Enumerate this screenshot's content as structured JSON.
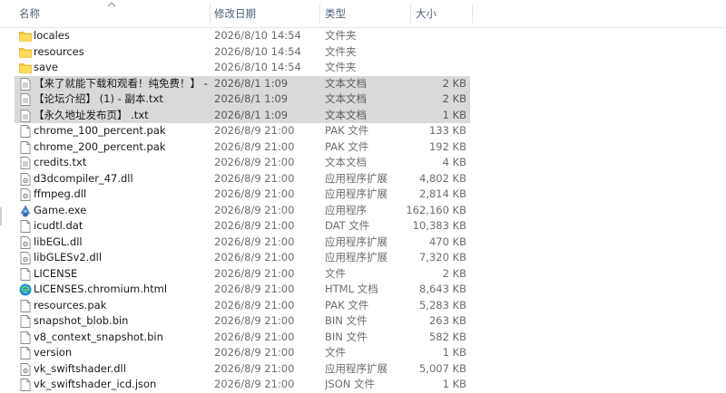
{
  "header": {
    "name_label": "名称",
    "date_label": "修改日期",
    "type_label": "类型",
    "size_label": "大小"
  },
  "files": [
    {
      "name": "locales",
      "date": "2026/8/10 14:54",
      "type": "文件夹",
      "size": "",
      "icon": "folder-icon",
      "selected": false
    },
    {
      "name": "resources",
      "date": "2026/8/10 14:54",
      "type": "文件夹",
      "size": "",
      "icon": "folder-icon",
      "selected": false
    },
    {
      "name": "save",
      "date": "2026/8/10 14:54",
      "type": "文件夹",
      "size": "",
      "icon": "folder-icon",
      "selected": false
    },
    {
      "name": "【来了就能下载和观看！纯免费！】 - 副...",
      "date": "2026/8/1 1:09",
      "type": "文本文档",
      "size": "2 KB",
      "icon": "text-file-icon",
      "selected": true
    },
    {
      "name": "【论坛介绍】 (1) - 副本.txt",
      "date": "2026/8/1 1:09",
      "type": "文本文档",
      "size": "2 KB",
      "icon": "text-file-icon",
      "selected": true
    },
    {
      "name": "【永久地址发布页】 .txt",
      "date": "2026/8/1 1:09",
      "type": "文本文档",
      "size": "1 KB",
      "icon": "text-file-icon",
      "selected": true
    },
    {
      "name": "chrome_100_percent.pak",
      "date": "2026/8/9 21:00",
      "type": "PAK 文件",
      "size": "133 KB",
      "icon": "file-icon",
      "selected": false
    },
    {
      "name": "chrome_200_percent.pak",
      "date": "2026/8/9 21:00",
      "type": "PAK 文件",
      "size": "192 KB",
      "icon": "file-icon",
      "selected": false
    },
    {
      "name": "credits.txt",
      "date": "2026/8/9 21:00",
      "type": "文本文档",
      "size": "4 KB",
      "icon": "text-file-icon",
      "selected": false
    },
    {
      "name": "d3dcompiler_47.dll",
      "date": "2026/8/9 21:00",
      "type": "应用程序扩展",
      "size": "4,802 KB",
      "icon": "dll-file-icon",
      "selected": false
    },
    {
      "name": "ffmpeg.dll",
      "date": "2026/8/9 21:00",
      "type": "应用程序扩展",
      "size": "2,814 KB",
      "icon": "dll-file-icon",
      "selected": false
    },
    {
      "name": "Game.exe",
      "date": "2026/8/9 21:00",
      "type": "应用程序",
      "size": "162,160 KB",
      "icon": "app-exe-icon",
      "selected": false
    },
    {
      "name": "icudtl.dat",
      "date": "2026/8/9 21:00",
      "type": "DAT 文件",
      "size": "10,383 KB",
      "icon": "file-icon",
      "selected": false
    },
    {
      "name": "libEGL.dll",
      "date": "2026/8/9 21:00",
      "type": "应用程序扩展",
      "size": "470 KB",
      "icon": "dll-file-icon",
      "selected": false
    },
    {
      "name": "libGLESv2.dll",
      "date": "2026/8/9 21:00",
      "type": "应用程序扩展",
      "size": "7,320 KB",
      "icon": "dll-file-icon",
      "selected": false
    },
    {
      "name": "LICENSE",
      "date": "2026/8/9 21:00",
      "type": "文件",
      "size": "2 KB",
      "icon": "file-icon",
      "selected": false
    },
    {
      "name": "LICENSES.chromium.html",
      "date": "2026/8/9 21:00",
      "type": "HTML 文档",
      "size": "8,643 KB",
      "icon": "edge-html-icon",
      "selected": false
    },
    {
      "name": "resources.pak",
      "date": "2026/8/9 21:00",
      "type": "PAK 文件",
      "size": "5,283 KB",
      "icon": "file-icon",
      "selected": false
    },
    {
      "name": "snapshot_blob.bin",
      "date": "2026/8/9 21:00",
      "type": "BIN 文件",
      "size": "263 KB",
      "icon": "file-icon",
      "selected": false
    },
    {
      "name": "v8_context_snapshot.bin",
      "date": "2026/8/9 21:00",
      "type": "BIN 文件",
      "size": "582 KB",
      "icon": "file-icon",
      "selected": false
    },
    {
      "name": "version",
      "date": "2026/8/9 21:00",
      "type": "文件",
      "size": "1 KB",
      "icon": "file-icon",
      "selected": false
    },
    {
      "name": "vk_swiftshader.dll",
      "date": "2026/8/9 21:00",
      "type": "应用程序扩展",
      "size": "5,007 KB",
      "icon": "dll-file-icon",
      "selected": false
    },
    {
      "name": "vk_swiftshader_icd.json",
      "date": "2026/8/9 21:00",
      "type": "JSON 文件",
      "size": "1 KB",
      "icon": "file-icon",
      "selected": false
    }
  ]
}
